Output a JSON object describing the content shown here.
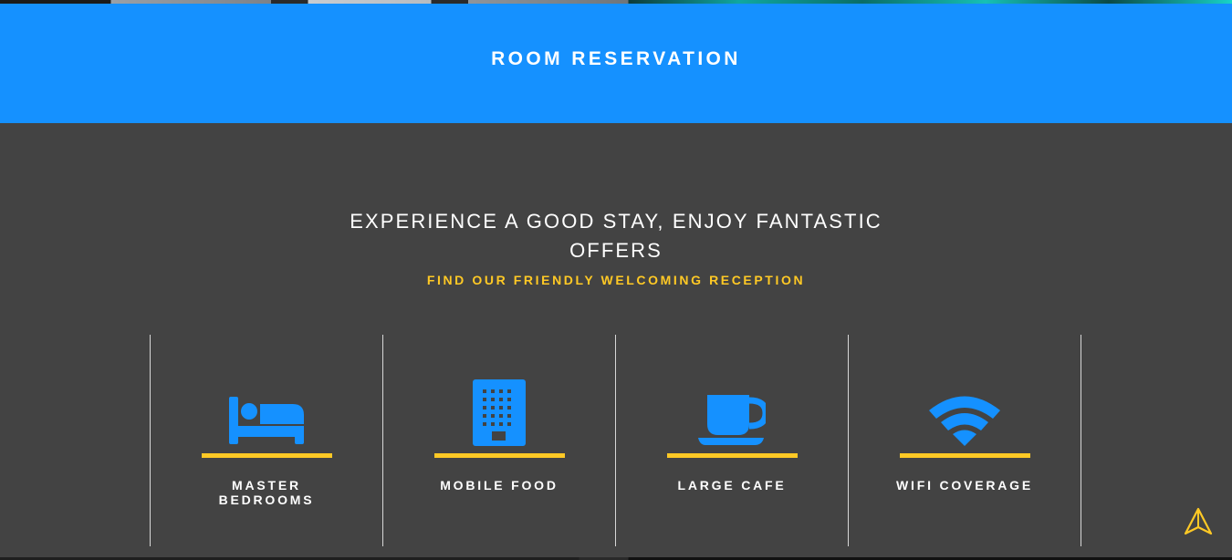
{
  "banner": {
    "title": "ROOM RESERVATION",
    "color": "#1591ff"
  },
  "intro": {
    "headline": "EXPERIENCE A GOOD STAY, ENJOY FANTASTIC OFFERS",
    "subheadline": "FIND OUR FRIENDLY WELCOMING RECEPTION"
  },
  "features": [
    {
      "label": "MASTER BEDROOMS",
      "icon": "bed-icon"
    },
    {
      "label": "MOBILE FOOD",
      "icon": "building-icon"
    },
    {
      "label": "LARGE CAFE",
      "icon": "coffee-cup-icon"
    },
    {
      "label": "WIFI COVERAGE",
      "icon": "wifi-icon"
    }
  ],
  "colors": {
    "accent": "#1591ff",
    "highlight": "#ffc925",
    "background": "#434343"
  },
  "scroll_top": {
    "icon": "navigation-arrow-icon"
  }
}
